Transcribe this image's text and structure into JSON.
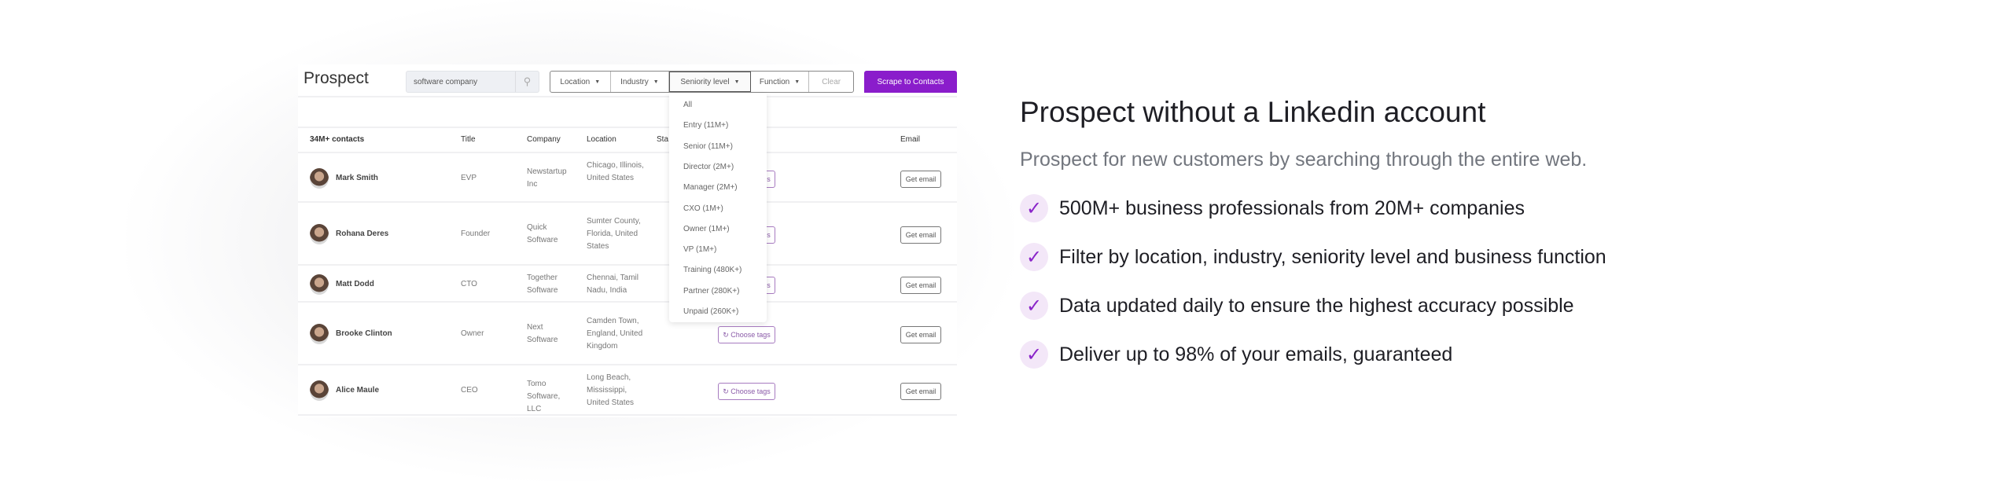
{
  "app": {
    "title": "Prospect",
    "search_value": "software company",
    "search_icon": "magnifier-icon",
    "filters": [
      "Location",
      "Industry",
      "Seniority level",
      "Function"
    ],
    "clear_label": "Clear",
    "scrape_label": "Scrape to Contacts"
  },
  "table": {
    "headers": [
      "34M+ contacts",
      "Title",
      "Company",
      "Location",
      "Sta",
      "Email"
    ],
    "rows": [
      {
        "name": "Mark Smith",
        "title": "EVP",
        "company": "Newstartup Inc",
        "location": "Chicago, Illinois, United States",
        "tags": "Choose tags",
        "email": "Get email"
      },
      {
        "name": "Rohana Deres",
        "title": "Founder",
        "company": "Quick Software",
        "location": "Sumter County, Florida, United States",
        "tags": "Choose tags",
        "email": "Get email"
      },
      {
        "name": "Matt Dodd",
        "title": "CTO",
        "company": "Together Software",
        "location": "Chennai, Tamil Nadu, India",
        "tags": "Choose tags",
        "email": "Get email"
      },
      {
        "name": "Brooke Clinton",
        "title": "Owner",
        "company": "Next Software",
        "location": "Camden Town, England, United Kingdom",
        "tags": "Choose tags",
        "email": "Get email"
      },
      {
        "name": "Alice Maule",
        "title": "CEO",
        "company": "Tomo Software, LLC",
        "location": "Long Beach, Mississippi, United States",
        "tags": "Choose tags",
        "email": "Get email"
      }
    ]
  },
  "seniority_dropdown": [
    "All",
    "Entry (11M+)",
    "Senior (11M+)",
    "Director (2M+)",
    "Manager (2M+)",
    "CXO (1M+)",
    "Owner (1M+)",
    "VP (1M+)",
    "Training (480K+)",
    "Partner (280K+)",
    "Unpaid (260K+)"
  ],
  "feature": {
    "heading": "Prospect without a Linkedin account",
    "subtitle": "Prospect for new customers by searching through the entire web.",
    "bullets": [
      "500M+ business professionals from 20M+ companies",
      "Filter by location, industry, seniority level and business function",
      "Data updated daily to ensure the highest accuracy possible",
      "Deliver up to 98% of your emails, guaranteed"
    ],
    "check_icon": "checkmark-icon"
  },
  "colors": {
    "accent": "#8a1dcb",
    "check_bg": "#f3e7f8"
  }
}
